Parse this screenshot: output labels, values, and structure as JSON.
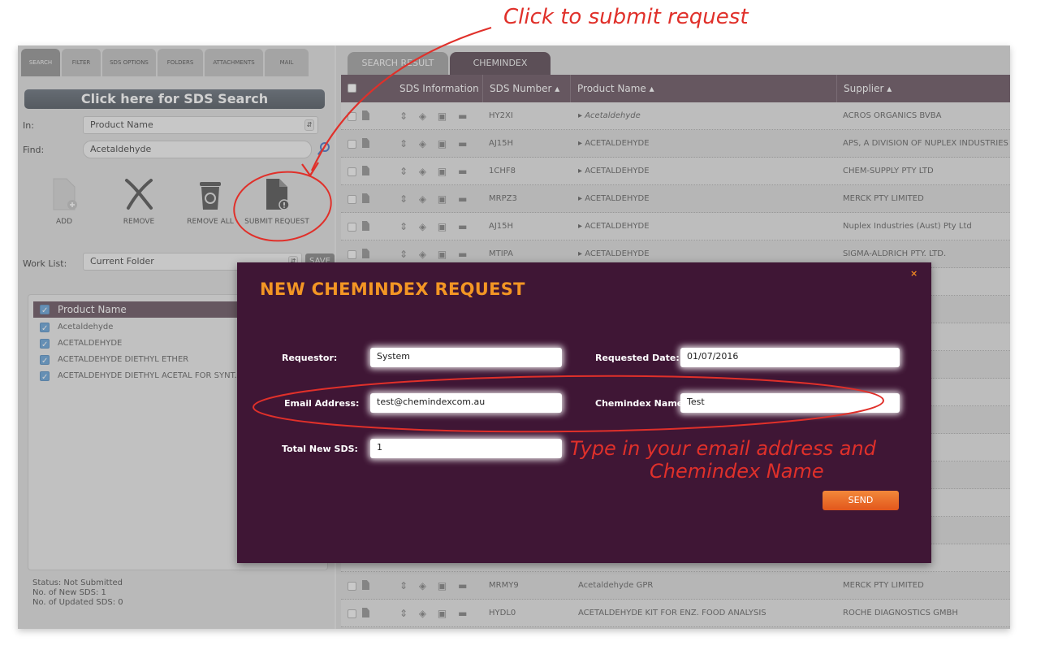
{
  "annotations": {
    "top_callout": "Click to submit request",
    "bottom_callout_line1": "Type in your email address and",
    "bottom_callout_line2": "Chemindex Name"
  },
  "left_tabs": [
    "SEARCH",
    "FILTER",
    "SDS OPTIONS",
    "FOLDERS",
    "ATTACHMENTS",
    "MAIL"
  ],
  "search_banner": "Click here for SDS Search",
  "in_label": "In:",
  "in_value": "Product Name",
  "find_label": "Find:",
  "find_value": "Acetaldehyde",
  "tools": {
    "add": "ADD",
    "remove": "REMOVE",
    "remove_all": "REMOVE ALL",
    "submit": "SUBMIT REQUEST"
  },
  "worklist_label": "Work List:",
  "worklist_value": "Current Folder",
  "save_label": "SAVE",
  "worklist_header": "Product Name",
  "worklist_items": [
    "Acetaldehyde",
    "ACETALDEHYDE",
    "ACETALDEHYDE DIETHYL ETHER",
    "ACETALDEHYDE DIETHYL ACETAL FOR SYNT..."
  ],
  "status": {
    "line1": "Status: Not Submitted",
    "line2": "No. of New SDS: 1",
    "line3": "No. of Updated SDS: 0"
  },
  "right_tabs": [
    "SEARCH RESULT",
    "CHEMINDEX"
  ],
  "table": {
    "headers": [
      "SDS Information",
      "SDS Number ▴",
      "Product Name ▴",
      "Supplier ▴"
    ],
    "rows": [
      {
        "sds": "HY2XI",
        "product": "Acetaldehyde",
        "supplier": "ACROS ORGANICS BVBA"
      },
      {
        "sds": "AJ15H",
        "product": "ACETALDEHYDE",
        "supplier": "APS, A DIVISION OF NUPLEX INDUSTRIES"
      },
      {
        "sds": "1CHF8",
        "product": "ACETALDEHYDE",
        "supplier": "CHEM-SUPPLY PTY LTD"
      },
      {
        "sds": "MRPZ3",
        "product": "ACETALDEHYDE",
        "supplier": "MERCK PTY LIMITED"
      },
      {
        "sds": "AJ15H",
        "product": "ACETALDEHYDE",
        "supplier": "Nuplex Industries (Aust) Pty Ltd"
      },
      {
        "sds": "MTIPA",
        "product": "ACETALDEHYDE",
        "supplier": "SIGMA-ALDRICH PTY. LTD."
      },
      {
        "sds": "",
        "product": "",
        "supplier": "LTD."
      },
      {
        "sds": "",
        "product": "",
        "supplier": "LTD."
      },
      {
        "sds": "",
        "product": "",
        "supplier": ""
      },
      {
        "sds": "",
        "product": "",
        "supplier": ""
      },
      {
        "sds": "",
        "product": "",
        "supplier": ""
      },
      {
        "sds": "",
        "product": "",
        "supplier": "UPLEX INDUSTRIES"
      },
      {
        "sds": "",
        "product": "",
        "supplier": "NTIFIC AUSTRALIA"
      },
      {
        "sds": "",
        "product": "",
        "supplier": ""
      },
      {
        "sds": "",
        "product": "",
        "supplier": ""
      },
      {
        "sds": "",
        "product": "",
        "supplier": ""
      },
      {
        "sds": "",
        "product": "",
        "supplier": "D"
      },
      {
        "sds": "MRMY9",
        "product": "Acetaldehyde GPR",
        "supplier": "MERCK PTY LIMITED"
      },
      {
        "sds": "HYDL0",
        "product": "ACETALDEHYDE KIT FOR ENZ. FOOD ANALYSIS",
        "supplier": "ROCHE DIAGNOSTICS GMBH"
      }
    ]
  },
  "modal": {
    "title": "NEW CHEMINDEX REQUEST",
    "close": "×",
    "requestor_label": "Requestor:",
    "requestor_value": "System",
    "requested_date_label": "Requested Date:",
    "requested_date_value": "01/07/2016",
    "email_label": "Email Address:",
    "email_value": "test@chemindexcom.au",
    "chemindex_name_label": "Chemindex Name:",
    "chemindex_name_value": "Test",
    "total_label": "Total New SDS:",
    "total_value": "1",
    "send_label": "SEND"
  },
  "colors": {
    "accent": "#5c4553",
    "modal_bg": "#3f1635",
    "title_orange": "#f39624",
    "annotation_red": "#e0302a"
  }
}
